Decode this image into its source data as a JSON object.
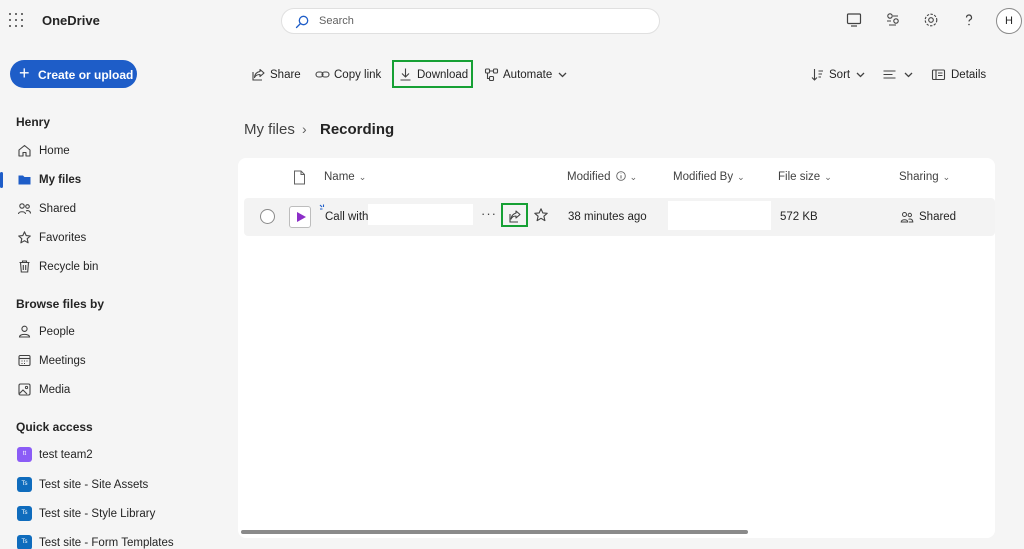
{
  "app": {
    "name": "OneDrive"
  },
  "search": {
    "placeholder": "Search"
  },
  "header_icons": [
    "monitor-icon",
    "people-connect-icon",
    "settings-icon",
    "help-icon"
  ],
  "user": {
    "initial": "H"
  },
  "sidebar": {
    "create_label": "Create or upload",
    "user_heading": "Henry",
    "items": [
      {
        "label": "Home",
        "icon": "home-icon"
      },
      {
        "label": "My files",
        "icon": "folder-icon",
        "active": true
      },
      {
        "label": "Shared",
        "icon": "people-icon"
      },
      {
        "label": "Favorites",
        "icon": "star-icon"
      },
      {
        "label": "Recycle bin",
        "icon": "trash-icon"
      }
    ],
    "browse_heading": "Browse files by",
    "browse_items": [
      {
        "label": "People",
        "icon": "person-icon"
      },
      {
        "label": "Meetings",
        "icon": "calendar-icon"
      },
      {
        "label": "Media",
        "icon": "image-icon"
      }
    ],
    "quick_heading": "Quick access",
    "quick_items": [
      {
        "label": "test team2",
        "badge": "tt",
        "color": "#8b5cf6"
      },
      {
        "label": "Test site - Site Assets",
        "badge": "Ts",
        "color": "#0f6cbd"
      },
      {
        "label": "Test site - Style Library",
        "badge": "Ts",
        "color": "#0f6cbd"
      },
      {
        "label": "Test site - Form Templates",
        "badge": "Ts",
        "color": "#0f6cbd"
      }
    ]
  },
  "toolbar": {
    "share": "Share",
    "copy_link": "Copy link",
    "download": "Download",
    "automate": "Automate",
    "sort": "Sort",
    "details": "Details"
  },
  "breadcrumb": {
    "parent": "My files",
    "current": "Recording"
  },
  "columns": {
    "name": "Name",
    "modified": "Modified",
    "modified_by": "Modified By",
    "file_size": "File size",
    "sharing": "Sharing"
  },
  "files": [
    {
      "name": "Call with",
      "modified": "38 minutes ago",
      "modified_by": "",
      "size": "572 KB",
      "sharing": "Shared"
    }
  ],
  "colors": {
    "accent": "#1e5dc8",
    "highlight": "#16a034",
    "video": "#8c2ec8"
  }
}
